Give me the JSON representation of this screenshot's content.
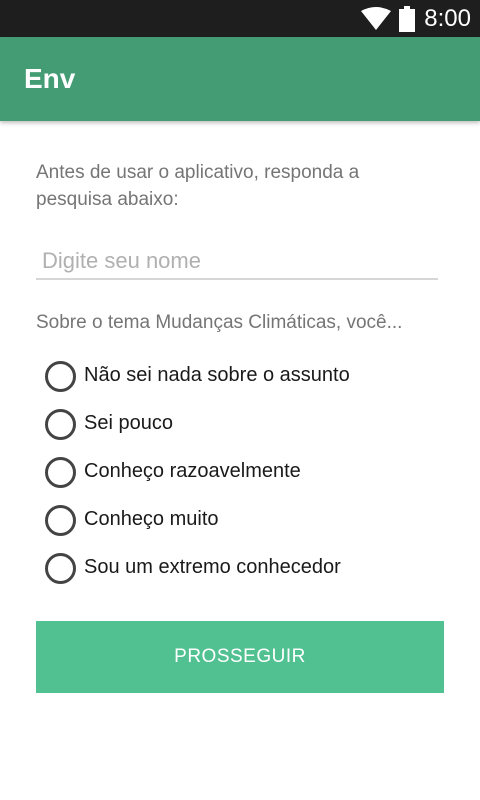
{
  "status_bar": {
    "time": "8:00",
    "icons": [
      "wifi-icon",
      "battery-icon"
    ]
  },
  "app_bar": {
    "title": "Env",
    "color": "#439c74"
  },
  "intro_text": "Antes de usar o aplicativo, responda a pesquisa abaixo:",
  "name_field": {
    "placeholder": "Digite seu nome",
    "value": ""
  },
  "question": "Sobre o tema Mudanças Climáticas, você...",
  "options": [
    {
      "label": "Não sei nada sobre o assunto",
      "selected": false
    },
    {
      "label": "Sei pouco",
      "selected": false
    },
    {
      "label": "Conheço razoavelmente",
      "selected": false
    },
    {
      "label": "Conheço muito",
      "selected": false
    },
    {
      "label": "Sou um extremo conhecedor",
      "selected": false
    }
  ],
  "submit_button": {
    "label": "PROSSEGUIR",
    "color": "#52c192"
  }
}
